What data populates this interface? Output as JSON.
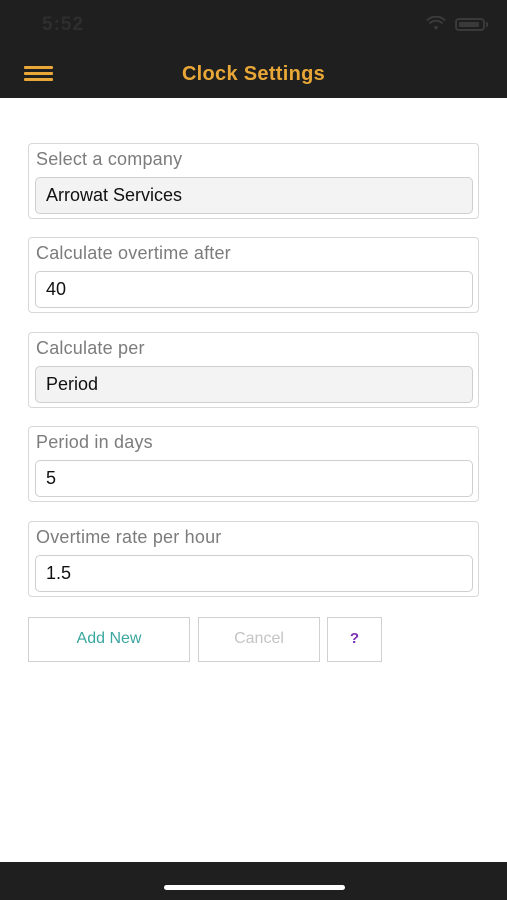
{
  "status_bar": {
    "time": "5:52",
    "icons": [
      "wifi-icon",
      "battery-icon"
    ]
  },
  "header": {
    "title": "Clock Settings",
    "menu_icon": "hamburger-menu-icon",
    "accent_color": "#e8a736",
    "background_color": "#1f1f1f"
  },
  "form": {
    "company": {
      "label": "Select a company",
      "value": "Arrowat Services"
    },
    "overtime_after": {
      "label": "Calculate overtime after",
      "value": "40"
    },
    "calculate_per": {
      "label": "Calculate per",
      "value": "Period"
    },
    "period_days": {
      "label": "Period in days",
      "value": "5"
    },
    "overtime_rate": {
      "label": "Overtime rate per hour",
      "value": "1.5"
    }
  },
  "buttons": {
    "add_new": "Add New",
    "cancel": "Cancel",
    "help": "?"
  },
  "colors": {
    "add_new_text": "#3aa6a0",
    "help_text": "#7b2fb5"
  }
}
